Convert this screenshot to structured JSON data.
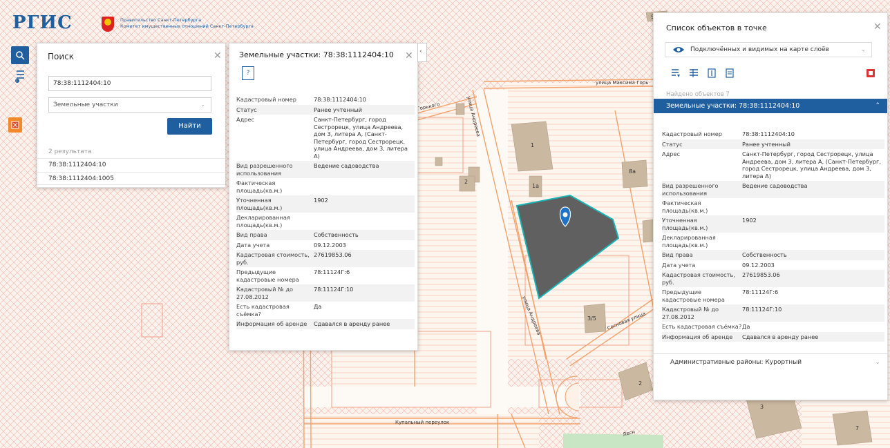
{
  "header": {
    "logo_text": "РГИС",
    "org_line1": "Правительство Санкт-Петербурга",
    "org_line2": "Комитет имущественных отношений Санкт-Петербурга"
  },
  "colors": {
    "accent": "#1f5f9f",
    "parcel_fill": "#606060",
    "parcel_stroke": "#19b5b5",
    "building": "#cbb8a0",
    "street": "#f4a26a",
    "hatch": "#f2b8a5"
  },
  "map": {
    "streets": {
      "gorkogo_short": "Горького",
      "maksima_gorkogo": "улица Максима Горь",
      "andreeva1": "улица Андреева",
      "andreeva2": "улица Андреева",
      "sosnovaya": "Сосновая улица",
      "kupalny": "Купальный переулок",
      "les": "Лесн"
    },
    "buildings": [
      "9",
      "1",
      "2",
      "1а",
      "8а",
      "3/5",
      "2",
      "3",
      "7"
    ]
  },
  "search_panel": {
    "title": "Поиск",
    "query_value": "78:38:1112404:10",
    "layer_select": "Земельные участки",
    "find_button": "Найти",
    "results_count": "2 результата",
    "results": [
      "78:38:1112404:10",
      "78:38:1112404:1005"
    ]
  },
  "info_panel": {
    "title": "Земельные участки: 78:38:1112404:10",
    "rows": [
      {
        "key": "Кадастровый номер",
        "value": "78:38:1112404:10"
      },
      {
        "key": "Статус",
        "value": "Ранее учтенный"
      },
      {
        "key": "Адрес",
        "value": "Санкт-Петербург, город Сестрорецк, улица Андреева, дом 3, литера А, (Санкт-Петербург, город Сестрорецк, улица Андреева, дом 3, литера А)"
      },
      {
        "key": "Вид разрешенного использования",
        "value": "Ведение садоводства"
      },
      {
        "key": "Фактическая площадь(кв.м.)",
        "value": ""
      },
      {
        "key": "Уточненная площадь(кв.м.)",
        "value": "1902"
      },
      {
        "key": "Декларированная площадь(кв.м.)",
        "value": ""
      },
      {
        "key": "Вид права",
        "value": "Собственность"
      },
      {
        "key": "Дата учета",
        "value": "09.12.2003"
      },
      {
        "key": "Кадастровая стоимость, руб.",
        "value": "27619853.06"
      },
      {
        "key": "Предыдущие кадастровые номера",
        "value": "78:11124Г:6"
      },
      {
        "key": "Кадастровый № до 27.08.2012",
        "value": "78:11124Г:10"
      },
      {
        "key": "Есть кадастровая съёмка?",
        "value": "Да"
      },
      {
        "key": "Информация об аренде",
        "value": "Сдавался в аренду ранее"
      }
    ]
  },
  "objects_panel": {
    "title": "Список объектов в точке",
    "layers_select": "Подключённых и видимых на карте слоёв",
    "found_count": "Найдено объектов 7",
    "section_header": "Земельные участки: 78:38:1112404:10",
    "footer_item": "Административные районы: Курортный"
  }
}
